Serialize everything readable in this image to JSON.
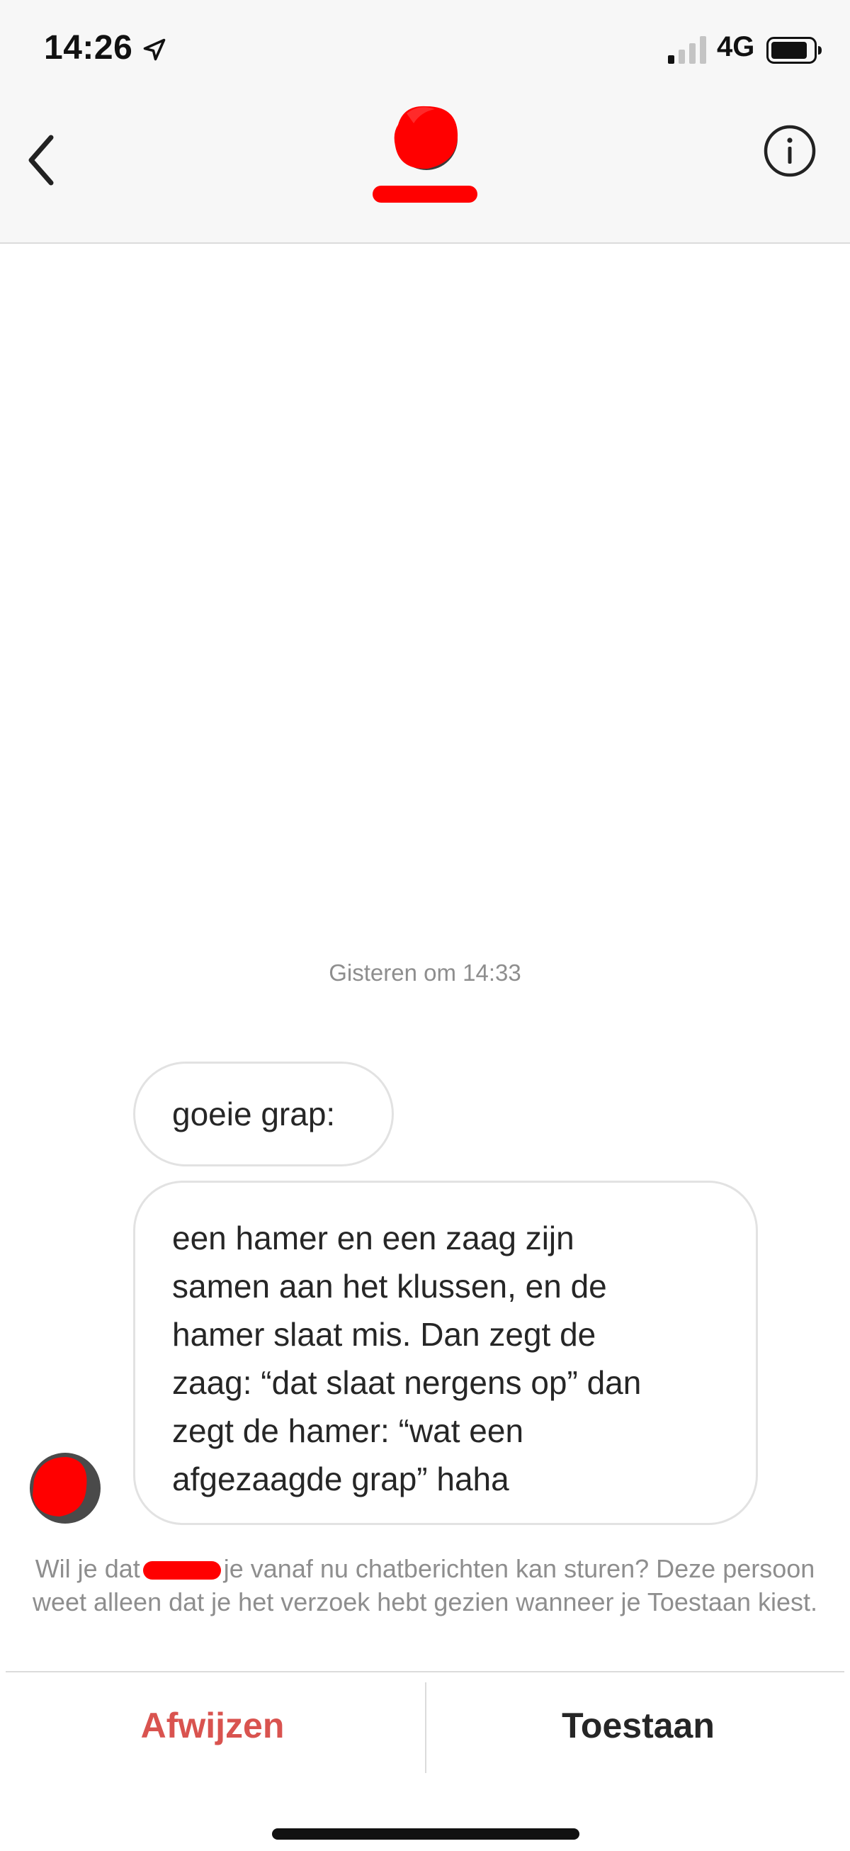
{
  "status_bar": {
    "time": "14:26",
    "network": "4G",
    "icons": [
      "location-arrow-icon",
      "signal-icon",
      "battery-icon"
    ]
  },
  "header": {
    "icons": [
      "back-chevron-icon",
      "info-icon"
    ]
  },
  "conversation": {
    "timestamp": "Gisteren om 14:33",
    "messages": [
      {
        "lines": [
          "goeie grap:"
        ]
      },
      {
        "lines": [
          "een hamer en een zaag zijn",
          "samen aan het klussen, en de",
          "hamer slaat mis. Dan zegt de",
          "zaag: “dat slaat nergens op” dan",
          "zegt de hamer: “wat een",
          "afgezaagde grap” haha"
        ]
      }
    ]
  },
  "request_notice": {
    "before": "Wil je dat",
    "after": "je vanaf nu chatberichten kan sturen? Deze persoon weet alleen dat je het verzoek hebt gezien wanneer je Toestaan kiest."
  },
  "actions": {
    "decline_label": "Afwijzen",
    "accept_label": "Toestaan"
  },
  "colors": {
    "decline": "#d9534f",
    "redaction": "#ff0000",
    "muted_text": "#8e8e8e",
    "bubble_border": "#e2e2e2"
  }
}
